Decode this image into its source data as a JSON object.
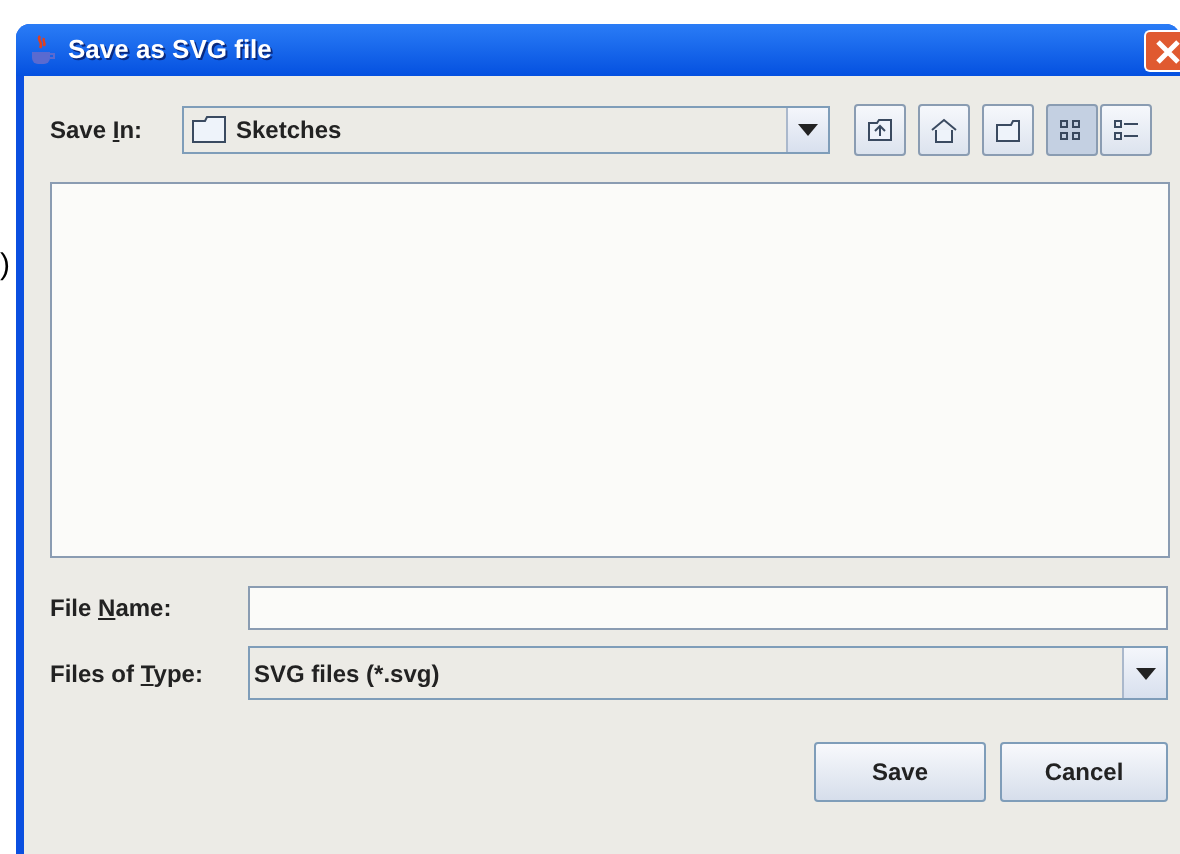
{
  "background_text": ")",
  "window": {
    "title": "Save as SVG file"
  },
  "save_in": {
    "label": {
      "before": "Save ",
      "mnemonic": "I",
      "after": "n:"
    },
    "value": "Sketches"
  },
  "toolbar": [
    {
      "kind": "up"
    },
    {
      "kind": "home"
    },
    {
      "kind": "new-folder"
    },
    {
      "kind": "list-view",
      "selected": true
    },
    {
      "kind": "details-view",
      "selected": false
    }
  ],
  "file_name": {
    "label": {
      "before": "File ",
      "mnemonic": "N",
      "after": "ame:"
    }
  },
  "files_of_type": {
    "label": {
      "before": "Files of ",
      "mnemonic": "T",
      "after": "ype:"
    },
    "value": "SVG files (*.svg)"
  },
  "buttons": [
    "Save",
    "Cancel"
  ]
}
